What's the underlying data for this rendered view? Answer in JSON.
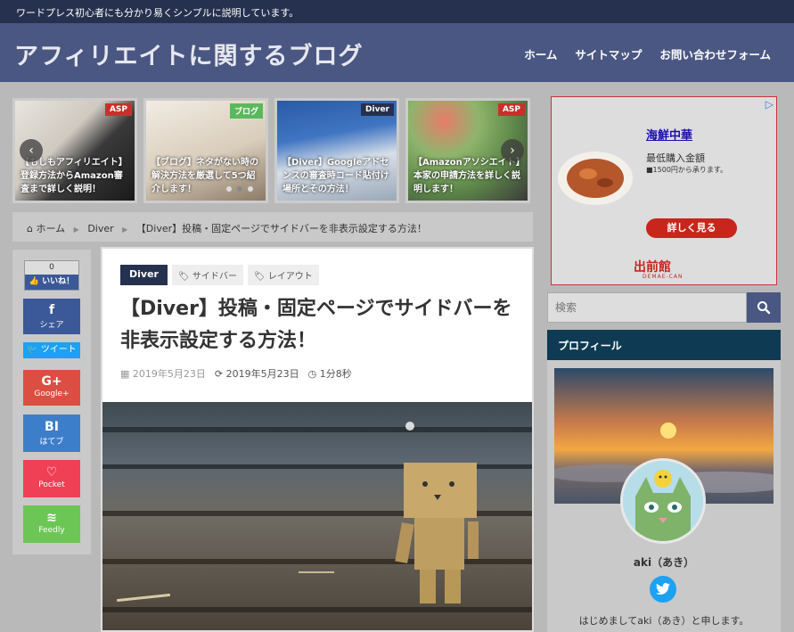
{
  "topbar": {
    "tagline": "ワードプレス初心者にも分かり易くシンプルに説明しています。"
  },
  "header": {
    "site_title": "アフィリエイトに関するブログ",
    "nav": [
      "ホーム",
      "サイトマップ",
      "お問い合わせフォーム"
    ]
  },
  "slider": {
    "slides": [
      {
        "category": "ASP",
        "category_color": "#c9302c",
        "caption": "【もしもアフィリエイト】登録方法からAmazon審査まで詳しく説明！"
      },
      {
        "category": "ブログ",
        "category_color": "#5cb85c",
        "caption": "【ブログ】ネタがない時の解決方法を厳選して5つ紹介します！"
      },
      {
        "category": "Diver",
        "category_color": "#26314f",
        "caption": "【Diver】Googleアドセンスの審査時コード貼付け場所とその方法！"
      },
      {
        "category": "ASP",
        "category_color": "#c9302c",
        "caption": "【Amazonアソシエイト】本家の申請方法を詳しく説明します！"
      }
    ],
    "prev": "‹",
    "next": "›"
  },
  "breadcrumb": {
    "home": "ホーム",
    "category": "Diver",
    "current": "【Diver】投稿・固定ページでサイドバーを非表示設定する方法！"
  },
  "share": {
    "like_count": "0",
    "like_label": "いいね！",
    "facebook": {
      "icon": "f",
      "label": "シェア",
      "color": "#3b5998"
    },
    "twitter": {
      "label": "ツイート",
      "color": "#1da1f2"
    },
    "google": {
      "icon": "G+",
      "label": "Google+",
      "color": "#dc4e41"
    },
    "hatena": {
      "icon": "BI",
      "label": "はてブ",
      "color": "#3d7ecb"
    },
    "pocket": {
      "label": "Pocket",
      "color": "#ef4056"
    },
    "feedly": {
      "label": "Feedly",
      "color": "#6cc655"
    }
  },
  "article": {
    "category": "Diver",
    "tags": [
      "サイドバー",
      "レイアウト"
    ],
    "title": "【Diver】投稿・固定ページでサイドバーを非表示設定する方法！",
    "published": "2019年5月23日",
    "updated": "2019年5月23日",
    "read_time": "1分8秒"
  },
  "ad": {
    "title": "海鮮中華",
    "subtitle": "最低購入金額",
    "small": "■1500円から承ります。",
    "button": "詳しく見る",
    "logo": "出前館",
    "logo_sub": "DEMAE-CAN"
  },
  "search": {
    "placeholder": "検索"
  },
  "profile": {
    "heading": "プロフィール",
    "name": "aki（あき）",
    "intro": "はじめましてaki（あき）と申します。"
  }
}
